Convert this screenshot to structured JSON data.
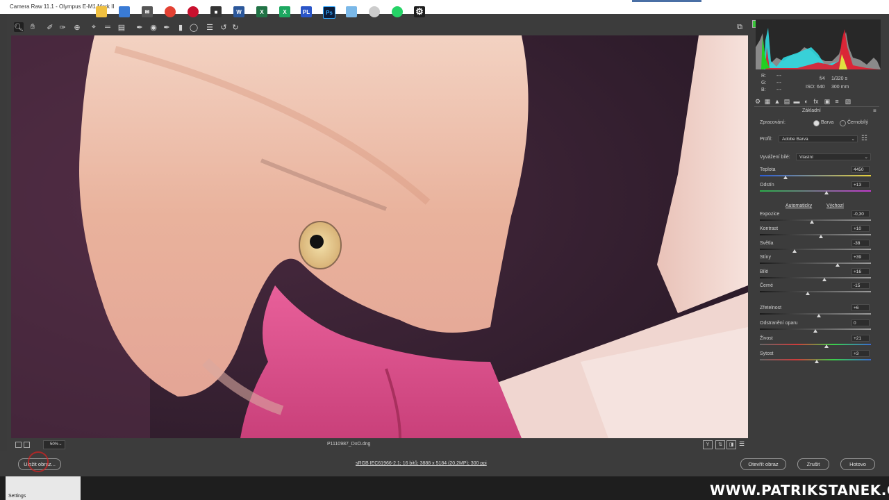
{
  "window": {
    "title": "Camera Raw 11.1  -  Olympus E-M1 Mark II"
  },
  "toolbar": {
    "tools": [
      "zoom-icon",
      "hand-icon",
      "white-balance-icon",
      "color-sampler-icon",
      "target-adjust-icon",
      "crop-icon",
      "straighten-icon",
      "transform-icon",
      "spot-removal-icon",
      "red-eye-icon",
      "adjustment-brush-icon",
      "graduated-filter-icon",
      "radial-filter-icon",
      "presets-list-icon",
      "rotate-left-icon",
      "rotate-right-icon"
    ],
    "fullscreen_icon": "open-fullscreen-icon"
  },
  "photo": {
    "filename": "P1110987_DxO.dng",
    "zoom": "50%"
  },
  "info": {
    "r_label": "R:",
    "g_label": "G:",
    "b_label": "B:",
    "r_value": "---",
    "g_value": "---",
    "b_value": "---",
    "aperture": "f/4",
    "shutter": "1/320 s",
    "iso": "ISO: 640",
    "focal": "300 mm"
  },
  "panel": {
    "section_title": "Základní",
    "processing_label": "Zpracování:",
    "processing_color": "Barva",
    "processing_bw": "Černobílý",
    "profile_label": "Profil:",
    "profile_value": "Adobe Barva",
    "wb_label": "Vyvážení bílé:",
    "wb_value": "Vlastní",
    "auto_link": "Automaticky",
    "default_link": "Výchozí",
    "sliders": [
      {
        "label": "Teplota",
        "value": "4450",
        "pos": 0.23
      },
      {
        "label": "Odstín",
        "value": "+13",
        "pos": 0.6
      },
      {
        "label": "Expozice",
        "value": "-0,30",
        "pos": 0.47
      },
      {
        "label": "Kontrast",
        "value": "+10",
        "pos": 0.55
      },
      {
        "label": "Světla",
        "value": "-38",
        "pos": 0.31
      },
      {
        "label": "Stíny",
        "value": "+39",
        "pos": 0.7
      },
      {
        "label": "Bílé",
        "value": "+16",
        "pos": 0.58
      },
      {
        "label": "Černé",
        "value": "-15",
        "pos": 0.43
      },
      {
        "label": "Zřetelnost",
        "value": "+6",
        "pos": 0.53
      },
      {
        "label": "Odstranění oparu",
        "value": "0",
        "pos": 0.5
      },
      {
        "label": "Živost",
        "value": "+21",
        "pos": 0.6
      },
      {
        "label": "Sytost",
        "value": "+3",
        "pos": 0.51
      }
    ]
  },
  "footer": {
    "save_button": "Uložit obraz...",
    "workflow_link": "sRGB IEC61966-2.1; 16 bitů; 3888 x 5184 (20,2MP); 300 ppi",
    "open_button": "Otevřít obraz",
    "cancel_button": "Zrušit",
    "done_button": "Hotovo"
  },
  "taskbar": {
    "settings_label": "Settings",
    "watermark": "WWW.PATRIKSTANEK.CZ"
  },
  "colors": {
    "panel_bg": "#3c3c3c",
    "accent_red_circle": "#d92020"
  }
}
